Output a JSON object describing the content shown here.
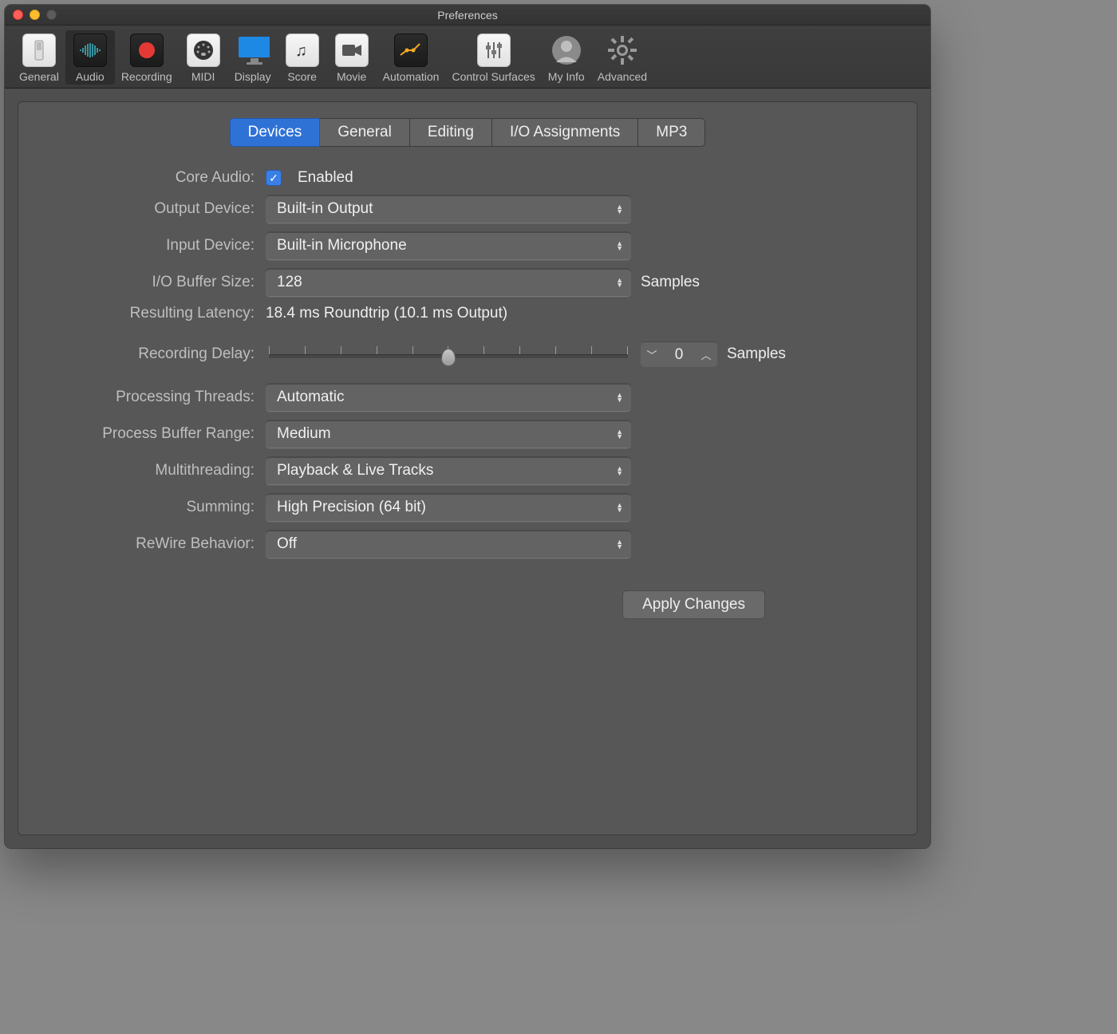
{
  "window": {
    "title": "Preferences"
  },
  "toolbar": {
    "items": [
      {
        "label": "General"
      },
      {
        "label": "Audio"
      },
      {
        "label": "Recording"
      },
      {
        "label": "MIDI"
      },
      {
        "label": "Display"
      },
      {
        "label": "Score"
      },
      {
        "label": "Movie"
      },
      {
        "label": "Automation"
      },
      {
        "label": "Control Surfaces"
      },
      {
        "label": "My Info"
      },
      {
        "label": "Advanced"
      }
    ]
  },
  "subtabs": [
    "Devices",
    "General",
    "Editing",
    "I/O Assignments",
    "MP3"
  ],
  "labels": {
    "core_audio": "Core Audio:",
    "enabled": "Enabled",
    "output_device": "Output Device:",
    "input_device": "Input Device:",
    "io_buffer": "I/O Buffer Size:",
    "samples": "Samples",
    "resulting_latency": "Resulting Latency:",
    "recording_delay": "Recording Delay:",
    "processing_threads": "Processing Threads:",
    "process_buffer_range": "Process Buffer Range:",
    "multithreading": "Multithreading:",
    "summing": "Summing:",
    "rewire": "ReWire Behavior:",
    "apply": "Apply Changes"
  },
  "values": {
    "output_device": "Built-in Output",
    "input_device": "Built-in Microphone",
    "io_buffer": "128",
    "latency": "18.4 ms Roundtrip (10.1 ms Output)",
    "recording_delay": "0",
    "processing_threads": "Automatic",
    "process_buffer_range": "Medium",
    "multithreading": "Playback & Live Tracks",
    "summing": "High Precision (64 bit)",
    "rewire": "Off"
  }
}
